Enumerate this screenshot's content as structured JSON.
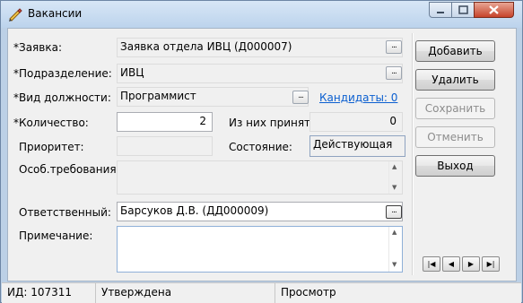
{
  "window": {
    "title": "Вакансии",
    "icon": "pen-icon"
  },
  "form": {
    "zayavka": {
      "label": "*Заявка:",
      "value": "Заявка отдела ИВЦ (Д000007)"
    },
    "podrazdelenie": {
      "label": "*Подразделение:",
      "value": "ИВЦ"
    },
    "dolzhnost": {
      "label": "*Вид должности:",
      "value": "Программист",
      "link": "Кандидаты: 0"
    },
    "kolichestvo": {
      "label": "*Количество:",
      "value": "2"
    },
    "prinyato": {
      "label": "Из них принято:",
      "value": "0"
    },
    "prioritet": {
      "label": "Приоритет:",
      "value": ""
    },
    "sostoyanie": {
      "label": "Состояние:",
      "value": "Действующая"
    },
    "trebovaniya": {
      "label": "Особ.требования:",
      "value": ""
    },
    "otvetstvenny": {
      "label": "Ответственный:",
      "value": "Барсуков Д.В. (ДД000009)"
    },
    "primechanie": {
      "label": "Примечание:",
      "value": ""
    },
    "dots": "..."
  },
  "buttons": {
    "add": {
      "label": "Добавить",
      "enabled": true
    },
    "delete": {
      "label": "Удалить",
      "enabled": true
    },
    "save": {
      "label": "Сохранить",
      "enabled": false
    },
    "cancel": {
      "label": "Отменить",
      "enabled": false
    },
    "exit": {
      "label": "Выход",
      "enabled": true
    }
  },
  "nav": {
    "first": "|◀",
    "prev": "◀",
    "next": "▶",
    "last": "▶|"
  },
  "statusbar": {
    "id": "ИД: 107311",
    "state": "Утверждена",
    "mode": "Просмотр"
  },
  "colors": {
    "link": "#0b5fd0",
    "close_button": "#c7442b"
  }
}
